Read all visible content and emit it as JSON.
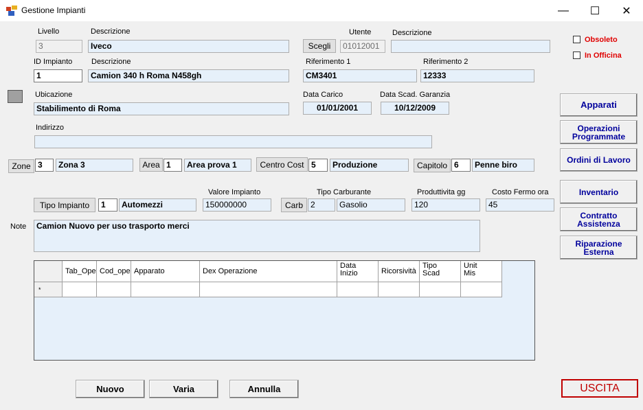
{
  "window": {
    "title": "Gestione Impianti",
    "minimize": "—",
    "maximize": "☐",
    "close": "✕"
  },
  "labels": {
    "livello": "Livello",
    "descrizione1": "Descrizione",
    "utente": "Utente",
    "descrizione2": "Descrizione",
    "id_impianto": "ID Impianto",
    "descrizione3": "Descrizione",
    "riferimento1": "Riferimento 1",
    "riferimento2": "Riferimento 2",
    "ubicazione": "Ubicazione",
    "data_carico": "Data Carico",
    "data_scad": "Data Scad. Garanzia",
    "indirizzo": "Indirizzo",
    "valore_impianto": "Valore Impianto",
    "tipo_carburante": "Tipo Carburante",
    "produttivita": "Produttivita gg",
    "costo_fermo": "Costo Fermo ora",
    "note": "Note"
  },
  "fields": {
    "livello": "3",
    "livello_desc": "Iveco",
    "utente": "01012001",
    "utente_desc": "",
    "id_impianto": "1",
    "impianto_desc": "Camion 340 h Roma N458gh",
    "riferimento1": "CM3401",
    "riferimento2": "12333",
    "ubicazione": "Stabilimento di Roma",
    "data_carico": "01/01/2001",
    "data_scad": "10/12/2009",
    "indirizzo": "",
    "zone_code": "3",
    "zone_desc": "Zona 3",
    "area_code": "1",
    "area_desc": "Area prova  1",
    "centro_code": "5",
    "centro_desc": "Produzione",
    "capitolo_code": "6",
    "capitolo_desc": "Penne biro",
    "tipo_imp_code": "1",
    "tipo_imp_desc": "Automezzi",
    "valore": "150000000",
    "carb_code": "2",
    "carb_desc": "Gasolio",
    "produttivita": "120",
    "costo_fermo": "45",
    "note": "Camion Nuovo per uso trasporto merci"
  },
  "buttons": {
    "scegli": "Scegli",
    "zone": "Zone",
    "area": "Area",
    "centro_cost": "Centro Cost",
    "capitolo": "Capitolo",
    "tipo_impianto": "Tipo Impianto",
    "carb": "Carb",
    "nuovo": "Nuovo",
    "varia": "Varia",
    "annulla": "Annulla",
    "uscita": "USCITA"
  },
  "checkboxes": {
    "obsoleto": "Obsoleto",
    "in_officina": "In Officina"
  },
  "side_buttons": {
    "apparati": "Apparati",
    "operazioni": "Operazioni\nProgrammate",
    "ordini": "Ordini di Lavoro",
    "inventario": "Inventario",
    "contratto": "Contratto\nAssistenza",
    "riparazione": "Riparazione\nEsterna"
  },
  "grid": {
    "columns": [
      "Tab_Ope",
      "Cod_ope",
      "Apparato",
      "Dex Operazione",
      "Data\nInizio",
      "Ricorsività",
      "Tipo\nScad",
      "Unit\nMis"
    ],
    "new_row_marker": "*"
  },
  "colors": {
    "accent_blue": "#00009c",
    "red": "#e00000",
    "field_bg": "#e6f0fa"
  }
}
